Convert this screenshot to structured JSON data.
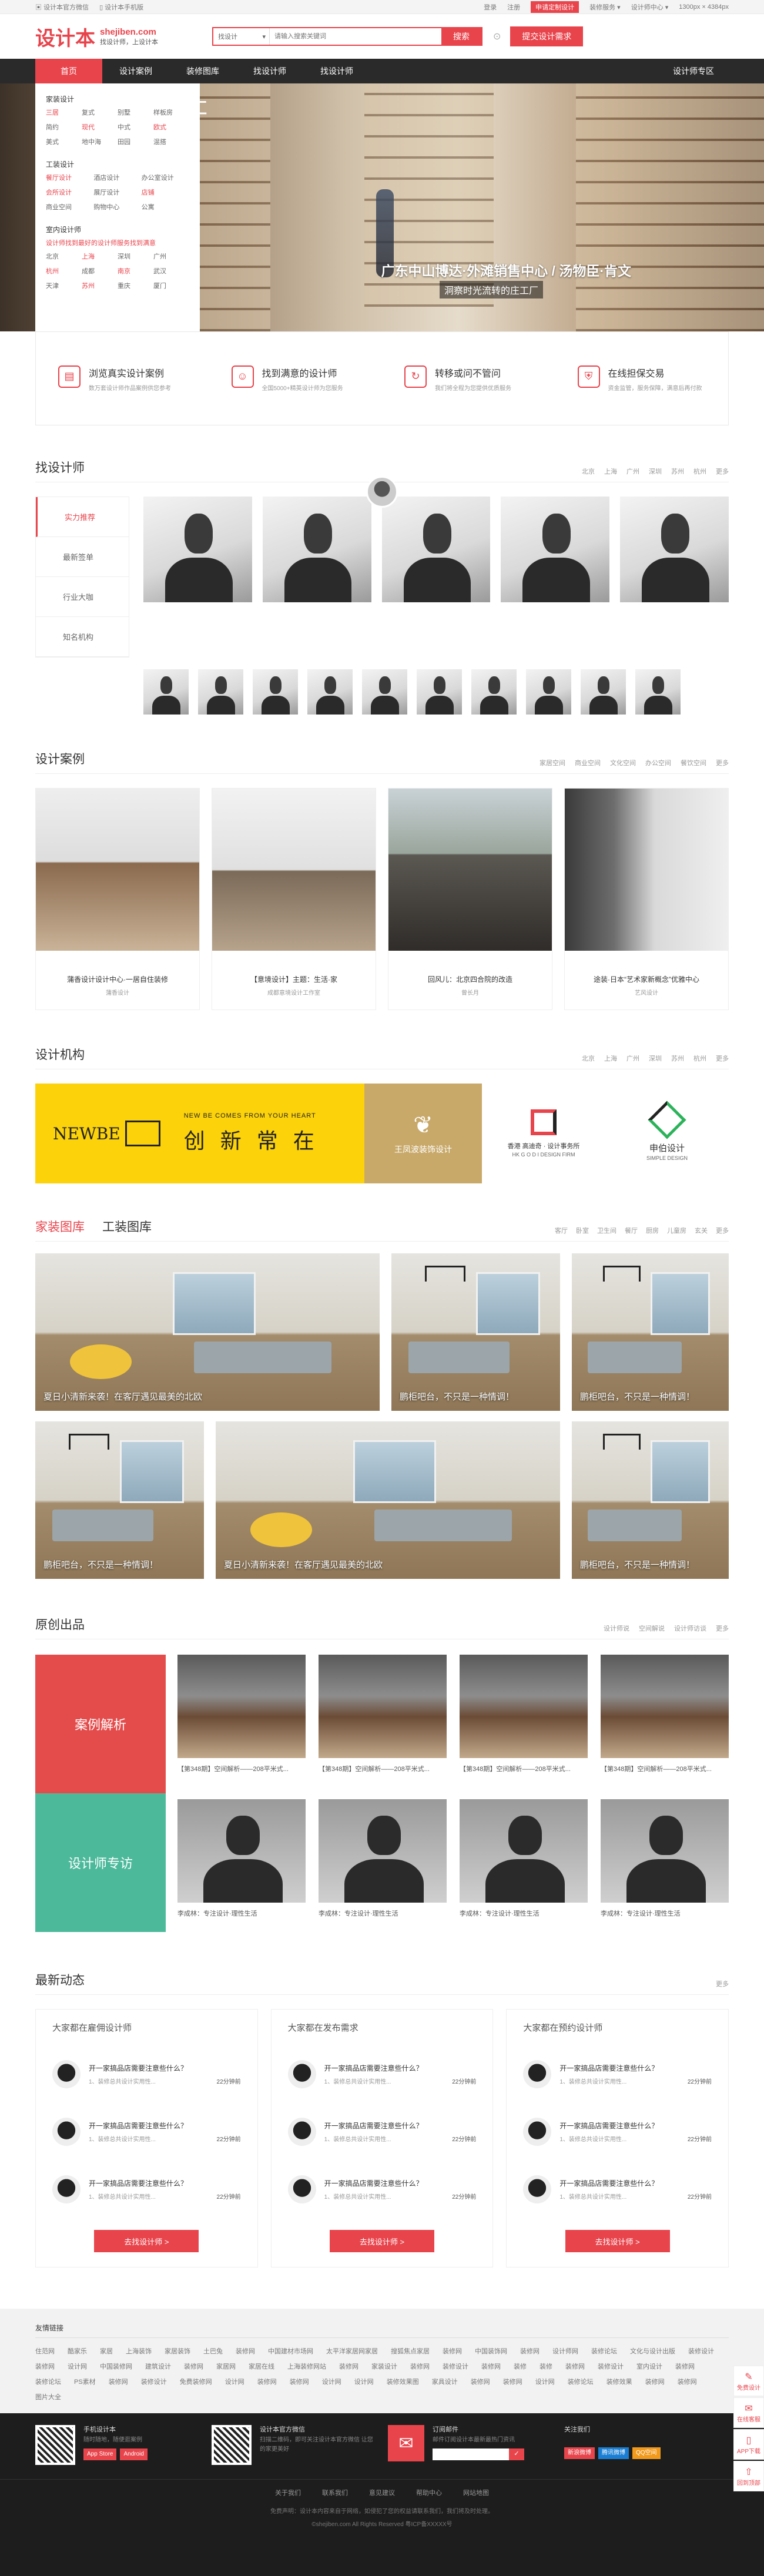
{
  "topbar": {
    "left": [
      "设计本官方微信",
      "设计本手机版"
    ],
    "right": [
      "登录",
      "注册",
      "申请定制设计",
      "装修服务",
      "设计师中心",
      "1300px",
      "4384px"
    ],
    "hot_index": 2
  },
  "header": {
    "logo_cn": "设计本",
    "logo_en": "shejiben.com",
    "slogan": "找设计师，上设计本",
    "search_select": "找设计",
    "search_placeholder": "请输入搜索关键词",
    "search_button": "搜索",
    "post_button": "提交设计需求"
  },
  "nav": {
    "items": [
      "首页",
      "设计案例",
      "装修图库",
      "找设计师",
      "找设计师"
    ],
    "active": 0,
    "right": "设计师专区"
  },
  "category": {
    "groups": [
      {
        "title": "家装设计",
        "links": [
          "三居",
          "复式",
          "别墅",
          "样板房",
          "简约",
          "现代",
          "中式",
          "欧式",
          "美式",
          "地中海",
          "田园",
          "混搭"
        ]
      },
      {
        "title": "工装设计",
        "links": [
          "餐厅设计",
          "酒店设计",
          "办公室设计",
          "会所设计",
          "展厅设计",
          "店铺",
          "商业空间",
          "购物中心",
          "公寓"
        ]
      },
      {
        "title": "室内设计师",
        "wide": "设计师找到最好的设计师服务找到满意",
        "links": [
          "北京",
          "上海",
          "深圳",
          "广州",
          "杭州",
          "成都",
          "南京",
          "武汉",
          "天津",
          "苏州",
          "重庆",
          "厦门"
        ]
      }
    ],
    "red": [
      "三居",
      "欧式",
      "现代",
      "餐厅设计",
      "店铺",
      "会所设计",
      "上海",
      "南京",
      "苏州",
      "杭州"
    ]
  },
  "banner": {
    "brand": "名汇",
    "title": "广东中山博达·外滩销售中心 / 汤物臣·肯文",
    "subtitle": "洞察时光流转的庄工厂"
  },
  "services": [
    {
      "icon": "document-icon",
      "title": "浏览真实设计案例",
      "desc": "数万套设计师作品案例供您参考"
    },
    {
      "icon": "person-icon",
      "title": "找到满意的设计师",
      "desc": "全国5000+精英设计师为您服务"
    },
    {
      "icon": "refresh-icon",
      "title": "转移或问不管问",
      "desc": "我们将全程为您提供优质服务"
    },
    {
      "icon": "shield-icon",
      "title": "在线担保交易",
      "desc": "资金监管，服务保障，满意后再付款"
    }
  ],
  "find_designer": {
    "title": "找设计师",
    "cities": [
      "北京",
      "上海",
      "广州",
      "深圳",
      "苏州",
      "杭州",
      "更多"
    ],
    "side": [
      "实力推荐",
      "最新签单",
      "行业大咖",
      "知名机构"
    ],
    "active": 0
  },
  "cases": {
    "title": "设计案例",
    "tabs": [
      "家居空间",
      "商业空间",
      "文化空间",
      "办公空间",
      "餐饮空间",
      "更多"
    ],
    "items": [
      {
        "title": "蒲香设计设计中心·一居自住装修",
        "name": "蒲香设计"
      },
      {
        "title": "【意境设计】主题：生活·家",
        "name": "成都意境设计工作室"
      },
      {
        "title": "回风儿：北京四合院的改造",
        "name": "曾长月"
      },
      {
        "title": "途装·日本“艺术家新概念”优雅中心",
        "name": "艺风设计"
      }
    ]
  },
  "orgs": {
    "title": "设计机构",
    "cities": [
      "北京",
      "上海",
      "广州",
      "深圳",
      "苏州",
      "杭州",
      "更多"
    ],
    "items": [
      {
        "logo": "NEWBE",
        "slogan": "NEW BE COMES FROM YOUR HEART",
        "cn": "创 新 常 在"
      },
      {
        "logo": "王凤波装饰设计"
      },
      {
        "logo": "香港 高迪奇 · 设计事务所",
        "en": "HK G O D I DESIGN FIRM"
      },
      {
        "logo": "申伯设计",
        "en": "SIMPLE DESIGN"
      }
    ]
  },
  "gallery": {
    "tabs": [
      "家装图库",
      "工装图库"
    ],
    "active": 0,
    "filters": [
      "客厅",
      "卧室",
      "卫生间",
      "餐厅",
      "厨房",
      "儿童房",
      "玄关",
      "更多"
    ],
    "items": [
      "夏日小清新来袭！在客厅遇见最美的北欧",
      "鹏柜吧台，不只是一种情调！",
      "鹏柜吧台，不只是一种情调！",
      "鹏柜吧台，不只是一种情调！",
      "夏日小清新来袭！在客厅遇见最美的北欧",
      "鹏柜吧台，不只是一种情调！"
    ]
  },
  "original": {
    "title": "原创出品",
    "links": [
      "设计师说",
      "空间解说",
      "设计师访谈",
      "更多"
    ],
    "blocks": [
      "案例解析",
      "设计师专访"
    ],
    "block_colors": [
      "#e44c4c",
      "#4cb99b"
    ],
    "items_top": [
      "【第348期】空间解析——208平米式...",
      "【第348期】空间解析——208平米式...",
      "【第348期】空间解析——208平米式...",
      "【第348期】空间解析——208平米式..."
    ],
    "items_bottom": [
      "李成林：专注设计·理性生活",
      "李成林：专注设计·理性生活",
      "李成林：专注设计·理性生活",
      "李成林：专注设计·理性生活"
    ]
  },
  "news": {
    "title": "最新动态",
    "more": "更多",
    "cols": [
      {
        "title": "大家都在雇佣设计师",
        "cta": "去找设计师 >",
        "rows": [
          {
            "a": "开一家搞品店需要注意些什么？",
            "b": "1、装修总共设计实用性...",
            "t": "22分钟前"
          },
          {
            "a": "开一家搞品店需要注意些什么？",
            "b": "1、装修总共设计实用性...",
            "t": "22分钟前"
          },
          {
            "a": "开一家搞品店需要注意些什么？",
            "b": "1、装修总共设计实用性...",
            "t": "22分钟前"
          }
        ]
      },
      {
        "title": "大家都在发布需求",
        "cta": "去找设计师 >",
        "rows": [
          {
            "a": "开一家搞品店需要注意些什么？",
            "b": "1、装修总共设计实用性...",
            "t": "22分钟前"
          },
          {
            "a": "开一家搞品店需要注意些什么？",
            "b": "1、装修总共设计实用性...",
            "t": "22分钟前"
          },
          {
            "a": "开一家搞品店需要注意些什么？",
            "b": "1、装修总共设计实用性...",
            "t": "22分钟前"
          }
        ]
      },
      {
        "title": "大家都在预约设计师",
        "cta": "去找设计师 >",
        "rows": [
          {
            "a": "开一家搞品店需要注意些什么？",
            "b": "1、装修总共设计实用性...",
            "t": "22分钟前"
          },
          {
            "a": "开一家搞品店需要注意些什么？",
            "b": "1、装修总共设计实用性...",
            "t": "22分钟前"
          },
          {
            "a": "开一家搞品店需要注意些什么？",
            "b": "1、装修总共设计实用性...",
            "t": "22分钟前"
          }
        ]
      }
    ]
  },
  "friend_links": {
    "title": "友情链接",
    "links": [
      "住范网",
      "酷家乐",
      "家居",
      "上海装饰",
      "家居装饰",
      "土巴兔",
      "装修网",
      "中国建材市场网",
      "太平洋家居网家居",
      "搜狐焦点家居",
      "装修网",
      "中国装饰网",
      "装修网",
      "设计师网",
      "装修论坛",
      "文化与设计出版",
      "装修设计",
      "装修网",
      "设计网",
      "中国装修网",
      "建筑设计",
      "装修网",
      "家居网",
      "家居在线",
      "上海装修网站",
      "装修网",
      "家装设计",
      "装修网",
      "装修设计",
      "装修网",
      "装修",
      "装修",
      "装修网",
      "装修设计",
      "室内设计",
      "装修网",
      "装修论坛",
      "PS素材",
      "装修网",
      "装修设计",
      "免费装修网",
      "设计网",
      "装修网",
      "装修网",
      "设计网",
      "设计网",
      "装修效果图",
      "家具设计",
      "装修网",
      "装修网",
      "设计网",
      "装修论坛",
      "装修效果",
      "装修网",
      "装修网",
      "图片大全"
    ]
  },
  "footer": {
    "cols": [
      {
        "title": "手机设计本",
        "desc": "随时随地，随便逛案例",
        "btns": [
          "App Store",
          "Android"
        ]
      },
      {
        "title": "设计本官方微信",
        "desc": "扫描二维码，即可关注设计本官方微信 让您的家更美好"
      },
      {
        "title": "订阅邮件",
        "desc": "邮件订阅设计本最新最热门资讯"
      },
      {
        "title": "关注我们",
        "btns": [
          "新浪微博",
          "腾讯微博",
          "QQ空间"
        ]
      }
    ],
    "links": [
      "关于我们",
      "联系我们",
      "意见建议",
      "帮助中心",
      "网站地图"
    ],
    "copyright": "免费声明：设计本内容来自于网络，如侵犯了您的权益请联系我们，我们将及时处理。",
    "icp": "©shejiben.com All Rights Reserved 粤ICP备XXXXX号"
  },
  "side_icons": [
    {
      "icon": "palette-icon",
      "label": "免费设计"
    },
    {
      "icon": "chat-icon",
      "label": "在线客服"
    },
    {
      "icon": "phone-icon",
      "label": "APP下载"
    },
    {
      "icon": "arrow-up-icon",
      "label": "回到顶部"
    }
  ],
  "accent": "#e8444c"
}
